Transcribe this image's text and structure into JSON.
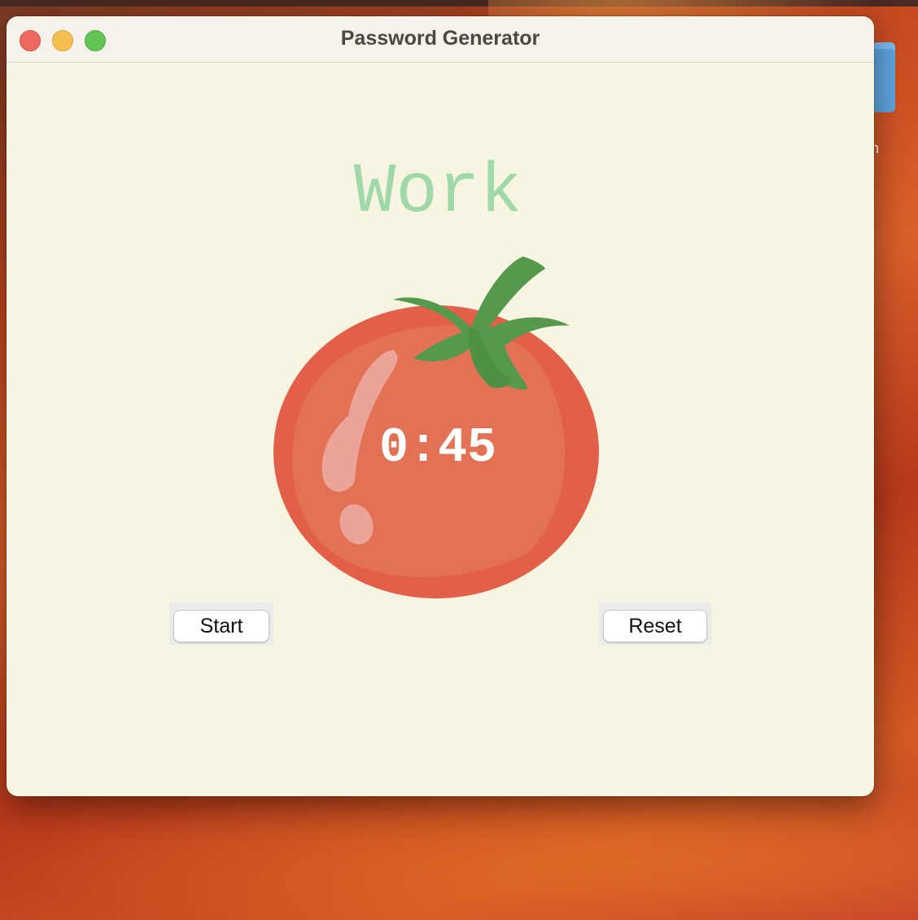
{
  "window": {
    "title": "Password Generator"
  },
  "desktop": {
    "label_fragment": "n"
  },
  "timer_app": {
    "heading": "Work",
    "time": "0:45",
    "start_label": "Start",
    "reset_label": "Reset"
  },
  "colors": {
    "window_bg": "#f7f5e2",
    "heading_green": "#9fd9a9",
    "tomato_red": "#e2604a",
    "leaf_green": "#559a4c"
  }
}
